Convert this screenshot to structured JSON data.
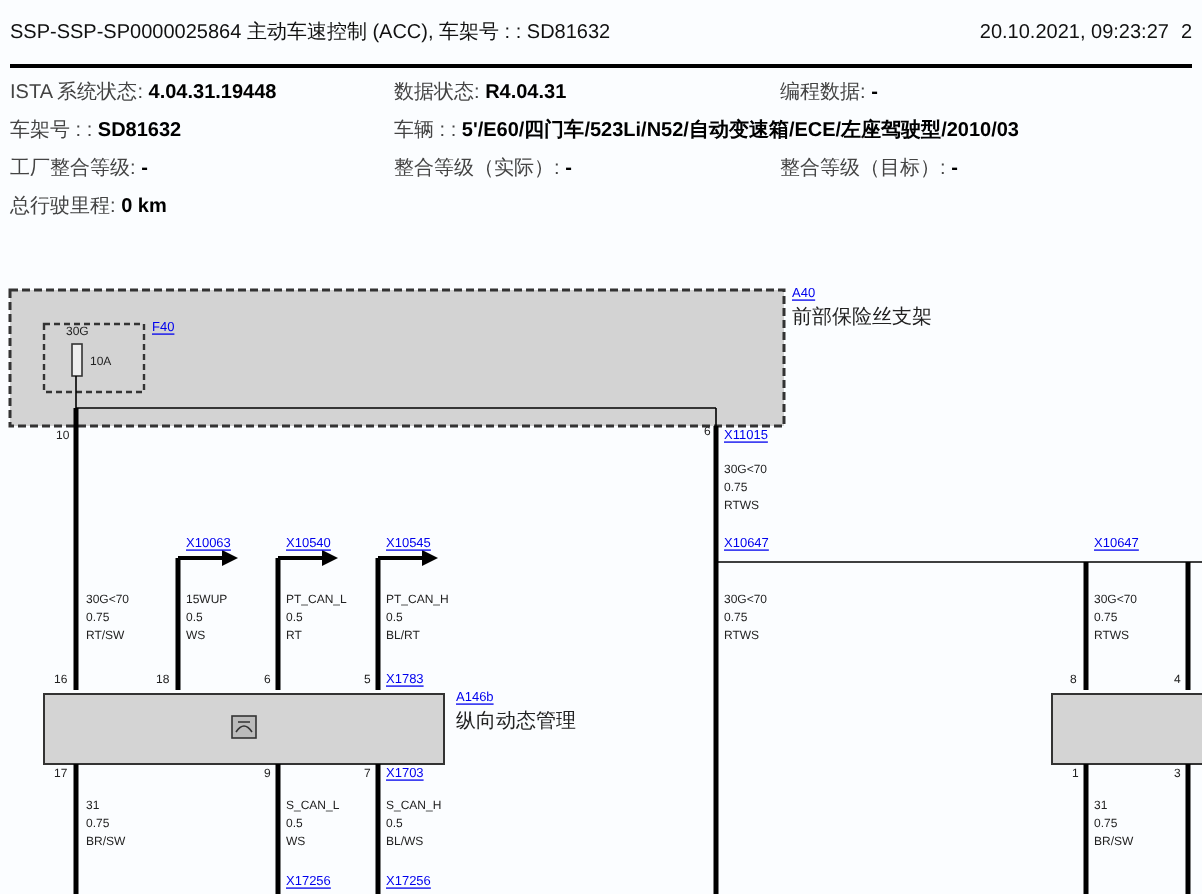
{
  "header": {
    "title": "SSP-SSP-SP0000025864 主动车速控制 (ACC), 车架号 : : SD81632",
    "timestamp": "20.10.2021, 09:23:27",
    "page": "2"
  },
  "info_rows": [
    [
      {
        "label": "ISTA 系统状态:",
        "value": "4.04.31.19448"
      },
      {
        "label": "数据状态:",
        "value": "R4.04.31"
      },
      {
        "label": "编程数据:",
        "value": "-"
      }
    ],
    [
      {
        "label": "车架号 : :",
        "value": "SD81632"
      },
      {
        "label": "车辆 : :",
        "value": "5'/E60/四门车/523Li/N52/自动变速箱/ECE/左座驾驶型/2010/03"
      }
    ],
    [
      {
        "label": "工厂整合等级:",
        "value": "-"
      },
      {
        "label": "整合等级（实际）:",
        "value": "-"
      },
      {
        "label": "整合等级（目标）:",
        "value": "-"
      }
    ],
    [
      {
        "label": "总行驶里程:",
        "value": "0 km"
      }
    ]
  ],
  "diagram": {
    "fuse_holder": {
      "ref": "A40",
      "name": "前部保险丝支架",
      "fuse_ref": "F40",
      "terminal": "30G",
      "rating": "10A"
    },
    "module": {
      "ref": "A146b",
      "name": "纵向动态管理"
    },
    "connector_links": [
      "X11015",
      "X10063",
      "X10540",
      "X10545",
      "X10647",
      "X10647",
      "X1783",
      "X1703",
      "X17256",
      "X17256"
    ],
    "wire_labels": [
      {
        "signal": "30G<70",
        "gauge": "0.75",
        "wire_code": "RT/SW"
      },
      {
        "signal": "15WUP",
        "gauge": "0.5",
        "wire_code": "WS"
      },
      {
        "signal": "PT_CAN_L",
        "gauge": "0.5",
        "wire_code": "RT"
      },
      {
        "signal": "PT_CAN_H",
        "gauge": "0.5",
        "wire_code": "BL/RT"
      },
      {
        "signal": "30G<70",
        "gauge": "0.75",
        "wire_code": "RTWS"
      },
      {
        "signal": "30G<70",
        "gauge": "0.75",
        "wire_code": "RTWS"
      },
      {
        "signal": "30G<70",
        "gauge": "0.75",
        "wire_code": "RTWS"
      },
      {
        "signal": "31",
        "gauge": "0.75",
        "wire_code": "BR/SW"
      },
      {
        "signal": "S_CAN_L",
        "gauge": "0.5",
        "wire_code": "WS"
      },
      {
        "signal": "S_CAN_H",
        "gauge": "0.5",
        "wire_code": "BL/WS"
      },
      {
        "signal": "31",
        "gauge": "0.75",
        "wire_code": "BR/SW"
      }
    ],
    "pins": [
      "10",
      "6",
      "16",
      "18",
      "6",
      "5",
      "17",
      "9",
      "7",
      "8",
      "4",
      "1",
      "3"
    ]
  }
}
